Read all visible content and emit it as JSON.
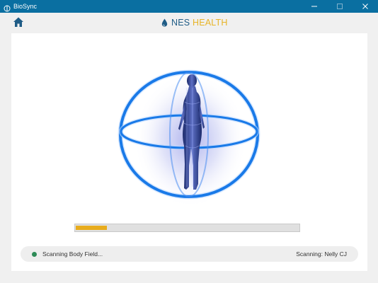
{
  "window": {
    "title": "BioSync"
  },
  "header": {
    "logo_nes": "NES",
    "logo_health": "HEALTH"
  },
  "progress": {
    "fraction": 0.14
  },
  "status": {
    "message": "Scanning Body Field...",
    "scanning_label": "Scanning: Nelly CJ",
    "indicator_color": "#2e8b57"
  },
  "colors": {
    "titlebar": "#0a6fa1",
    "progress_fill": "#e8ac1d",
    "logo_nes": "#1f5c86",
    "logo_health": "#e7b428"
  }
}
